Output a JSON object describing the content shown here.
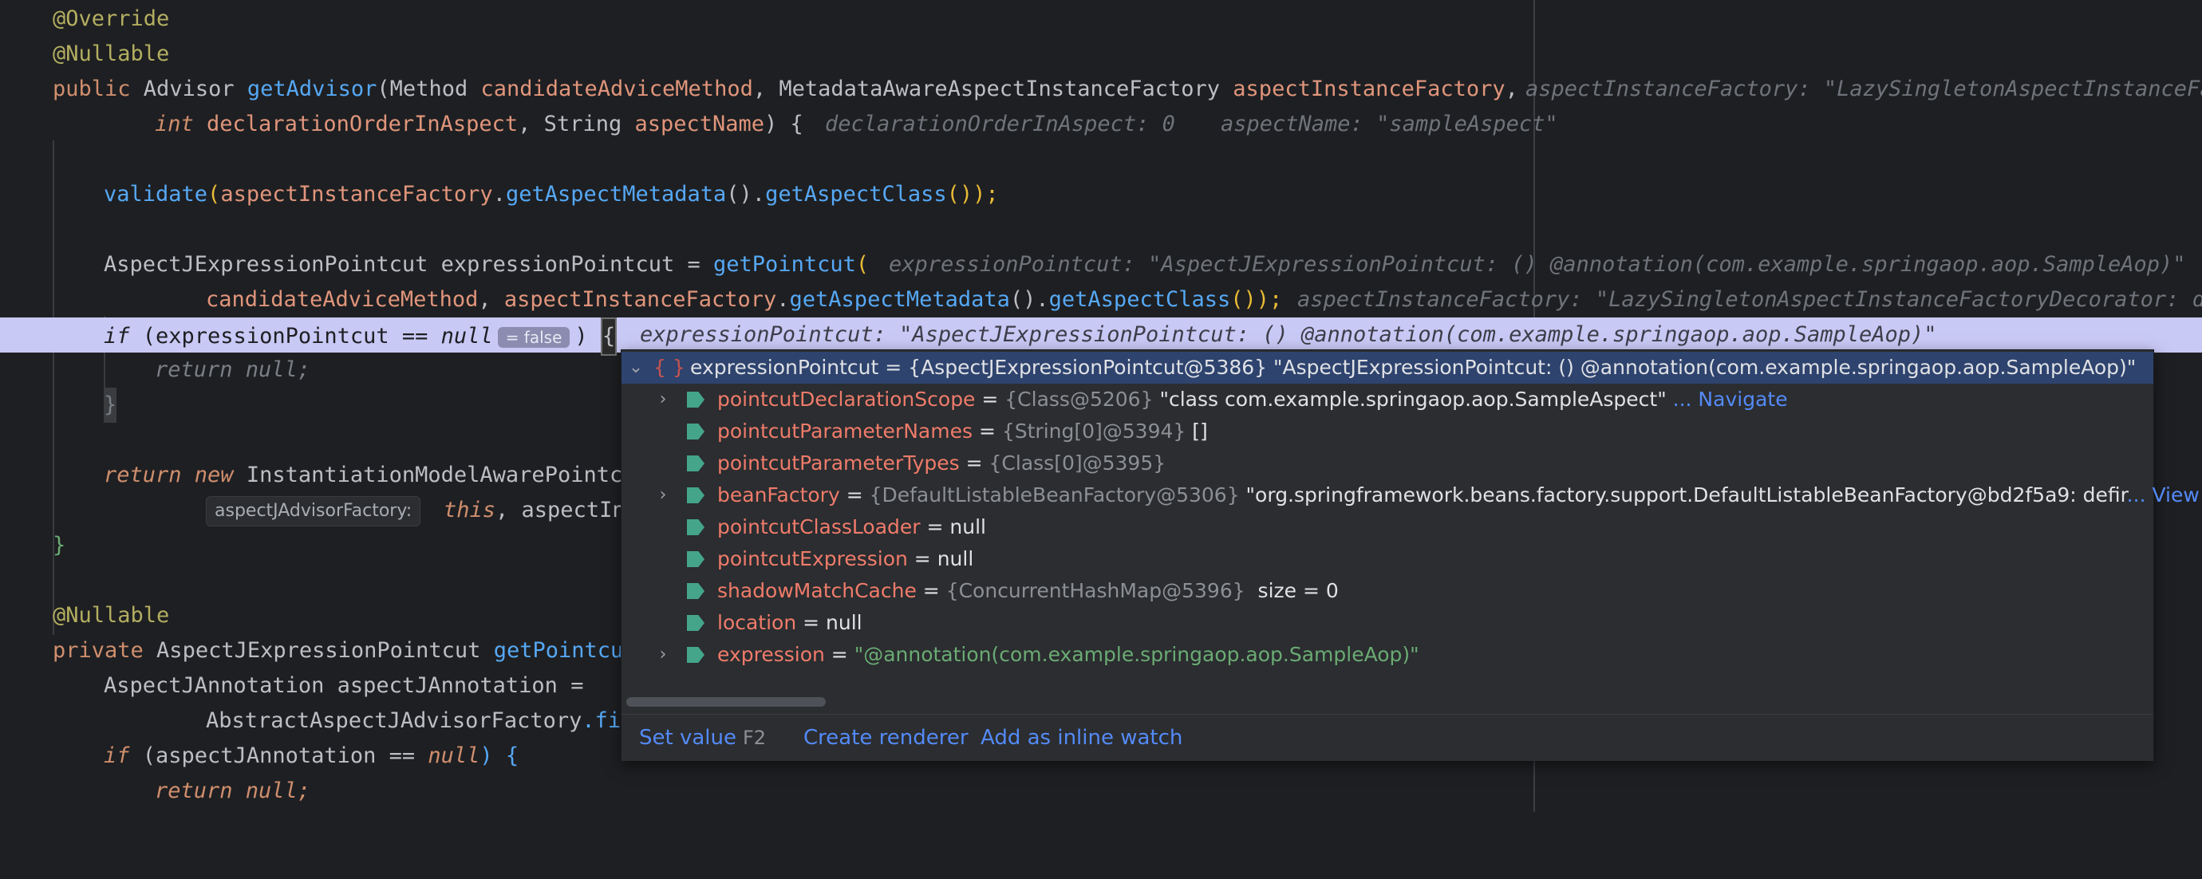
{
  "editor": {
    "lines": {
      "l1": "@Override",
      "l2": "@Nullable",
      "l3_pub": "public",
      "l3_type": " Advisor ",
      "l3_fn": "getAdvisor",
      "l3_p1": "(Method ",
      "l3_p1n": "candidateAdviceMethod",
      "l3_p2": ", MetadataAwareAspectInstanceFactory ",
      "l3_p2n": "aspectInstanceFactory",
      "l3_end": ",",
      "l3_hint": "aspectInstanceFactory: \"LazySingletonAspectInstanceFa",
      "l4_int": "int",
      "l4_p": " declarationOrderInAspect",
      "l4_s": ", String ",
      "l4_pn": "aspectName",
      "l4_end": ") {",
      "l4_hint1": "declarationOrderInAspect: 0",
      "l4_hint2": "aspectName: \"sampleAspect\"",
      "l6_fn": "validate",
      "l6_a": "(",
      "l6_b": "aspectInstanceFactory",
      "l6_c": ".",
      "l6_d": "getAspectMetadata",
      "l6_e": "().",
      "l6_f": "getAspectClass",
      "l6_g": "());",
      "l8_type": "AspectJExpressionPointcut ",
      "l8_var": "expressionPointcut",
      "l8_eq": " = ",
      "l8_fn": "getPointcut",
      "l8_open": "(",
      "l8_hint": "expressionPointcut: \"AspectJExpressionPointcut: () @annotation(com.example.springaop.aop.SampleAop)\"",
      "l9_a": "candidateAdviceMethod",
      "l9_b": ", ",
      "l9_c": "aspectInstanceFactory",
      "l9_d": ".",
      "l9_e": "getAspectMetadata",
      "l9_f": "().",
      "l9_g": "getAspectClass",
      "l9_h": "());",
      "l9_hint": "aspectInstanceFactory: \"LazySingletonAspectInstanceFactoryDecorator: de",
      "l10_if": "if",
      "l10_a": " (expressionPointcut == ",
      "l10_null": "null",
      "l10_false": "= false",
      "l10_close": ")",
      "l10_brace": "{",
      "l10_hint": "expressionPointcut: \"AspectJExpressionPointcut: () @annotation(com.example.springaop.aop.SampleAop)\"",
      "l11": "return null;",
      "l12": "}",
      "l14_ret": "return new",
      "l14_type": " InstantiationModelAwarePointcu",
      "l15_chip": "aspectJAdvisorFactory:",
      "l15_this": "this",
      "l15_rest": ", aspectIn",
      "l16": "}",
      "l18": "@Nullable",
      "l19_priv": "private",
      "l19_type": " AspectJExpressionPointcut ",
      "l19_fn": "getPointcut",
      "l20": "AspectJAnnotation aspectJAnnotation =",
      "l21_a": "AbstractAspectJAdvisorFactory",
      "l21_b": ".fi",
      "l22_if": "if",
      "l22_a": " (aspectJAnnotation == ",
      "l22_null": "null",
      "l22_b": ") {",
      "l23": "return null;"
    }
  },
  "popup": {
    "root": {
      "braces": "{ }",
      "name": "expressionPointcut",
      "eq": " = ",
      "value": "{AspectJExpressionPointcut@5386} \"AspectJExpressionPointcut: () @annotation(com.example.springaop.aop.SampleAop)\""
    },
    "rows": [
      {
        "name": "pointcutDeclarationScope",
        "eq": " = ",
        "type": "{Class@5206}",
        "value": " \"class com.example.springaop.aop.SampleAspect\"",
        "link": " ... Navigate"
      },
      {
        "name": "pointcutParameterNames",
        "eq": " = ",
        "type": "{String[0]@5394}",
        "value": " []"
      },
      {
        "name": "pointcutParameterTypes",
        "eq": " = ",
        "type": "{Class[0]@5395}"
      },
      {
        "name": "beanFactory",
        "eq": " = ",
        "type": "{DefaultListableBeanFactory@5306}",
        "value": " \"org.springframework.beans.factory.support.DefaultListableBeanFactory@bd2f5a9: defir",
        "link": "... View"
      },
      {
        "name": "pointcutClassLoader",
        "eq": " = ",
        "value": "null"
      },
      {
        "name": "pointcutExpression",
        "eq": " = ",
        "value": "null"
      },
      {
        "name": "shadowMatchCache",
        "eq": " = ",
        "type": "{ConcurrentHashMap@5396}",
        "value": "  size = 0"
      },
      {
        "name": "location",
        "eq": " = ",
        "value": "null"
      },
      {
        "name": "expression",
        "eq": " = ",
        "str": "\"@annotation(com.example.springaop.aop.SampleAop)\""
      }
    ],
    "footer": {
      "set_value": "Set value",
      "set_value_key": "F2",
      "create_renderer": "Create renderer",
      "add_inline_watch": "Add as inline watch"
    }
  }
}
